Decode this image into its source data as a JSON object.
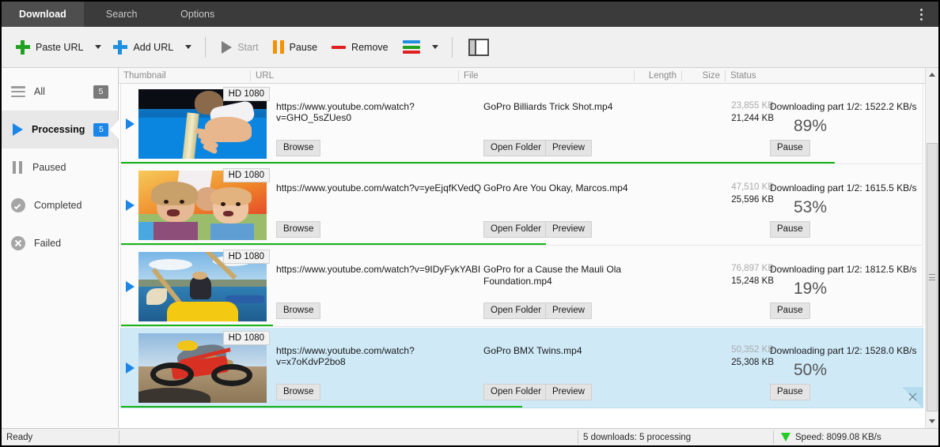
{
  "window": {
    "tabs": [
      {
        "label": "Download",
        "active": true
      },
      {
        "label": "Search",
        "active": false
      },
      {
        "label": "Options",
        "active": false
      }
    ],
    "menu_icon": "more-vertical-icon"
  },
  "toolbar": {
    "paste_url": "Paste URL",
    "add_url": "Add URL",
    "start": "Start",
    "pause": "Pause",
    "remove": "Remove",
    "quality_icon": "color-stripes-icon",
    "panel_icon": "split-panel-icon"
  },
  "sidebar": {
    "items": [
      {
        "label": "All",
        "badge": "5",
        "icon": "hamburger-icon",
        "active": false,
        "badge_color": "#7a7a7a"
      },
      {
        "label": "Processing",
        "badge": "5",
        "icon": "play-icon",
        "active": true,
        "badge_color": "#1b86e8"
      },
      {
        "label": "Paused",
        "badge": "",
        "icon": "pause-icon",
        "active": false
      },
      {
        "label": "Completed",
        "badge": "",
        "icon": "check-circle-icon",
        "active": false
      },
      {
        "label": "Failed",
        "badge": "",
        "icon": "x-circle-icon",
        "active": false
      }
    ]
  },
  "list": {
    "columns": {
      "thumbnail": "Thumbnail",
      "url": "URL",
      "file": "File",
      "length": "Length",
      "size": "Size",
      "status": "Status"
    },
    "buttons": {
      "browse": "Browse",
      "open_folder": "Open Folder",
      "preview": "Preview",
      "pause": "Pause"
    },
    "rows": [
      {
        "hd_badge": "HD 1080",
        "url": "https://www.youtube.com/watch?v=GHO_5sZUes0",
        "file": "GoPro  Billiards Trick Shot.mp4",
        "length": "",
        "size_total": "23,855 KB",
        "size_done": "21,244 KB",
        "status": "Downloading part 1/2: 1522.2 KB/s",
        "percent": "89%",
        "progress": 89,
        "selected": false,
        "thumb": "billiards"
      },
      {
        "hd_badge": "HD 1080",
        "url": "https://www.youtube.com/watch?v=yeEjqfKVedQ",
        "file": "GoPro  Are You Okay, Marcos.mp4",
        "length": "",
        "size_total": "47,510 KB",
        "size_done": "25,596 KB",
        "status": "Downloading part 1/2: 1615.5 KB/s",
        "percent": "53%",
        "progress": 53,
        "selected": false,
        "thumb": "kids"
      },
      {
        "hd_badge": "HD 1080",
        "url": "https://www.youtube.com/watch?v=9IDyFykYABI",
        "file": "GoPro for a Cause  the Mauli Ola Foundation.mp4",
        "length": "",
        "size_total": "76,897 KB",
        "size_done": "15,248 KB",
        "status": "Downloading part 1/2: 1812.5 KB/s",
        "percent": "19%",
        "progress": 19,
        "selected": false,
        "thumb": "kayak"
      },
      {
        "hd_badge": "HD 1080",
        "url": "https://www.youtube.com/watch?v=x7oKdvP2bo8",
        "file": "GoPro  BMX Twins.mp4",
        "length": "",
        "size_total": "50,352 KB",
        "size_done": "25,308 KB",
        "status": "Downloading part 1/2: 1528.0 KB/s",
        "percent": "50%",
        "progress": 50,
        "selected": true,
        "thumb": "bmx"
      }
    ]
  },
  "statusbar": {
    "left": "Ready",
    "middle": "5 downloads: 5 processing",
    "right": "Speed: 8099.08 KB/s",
    "speed_icon": "download-arrow-icon"
  },
  "colors": {
    "accent_blue": "#1b86e8",
    "progress_green": "#17b517",
    "selection_blue": "#cfe9f7",
    "titlebar": "#3b3b3b"
  }
}
